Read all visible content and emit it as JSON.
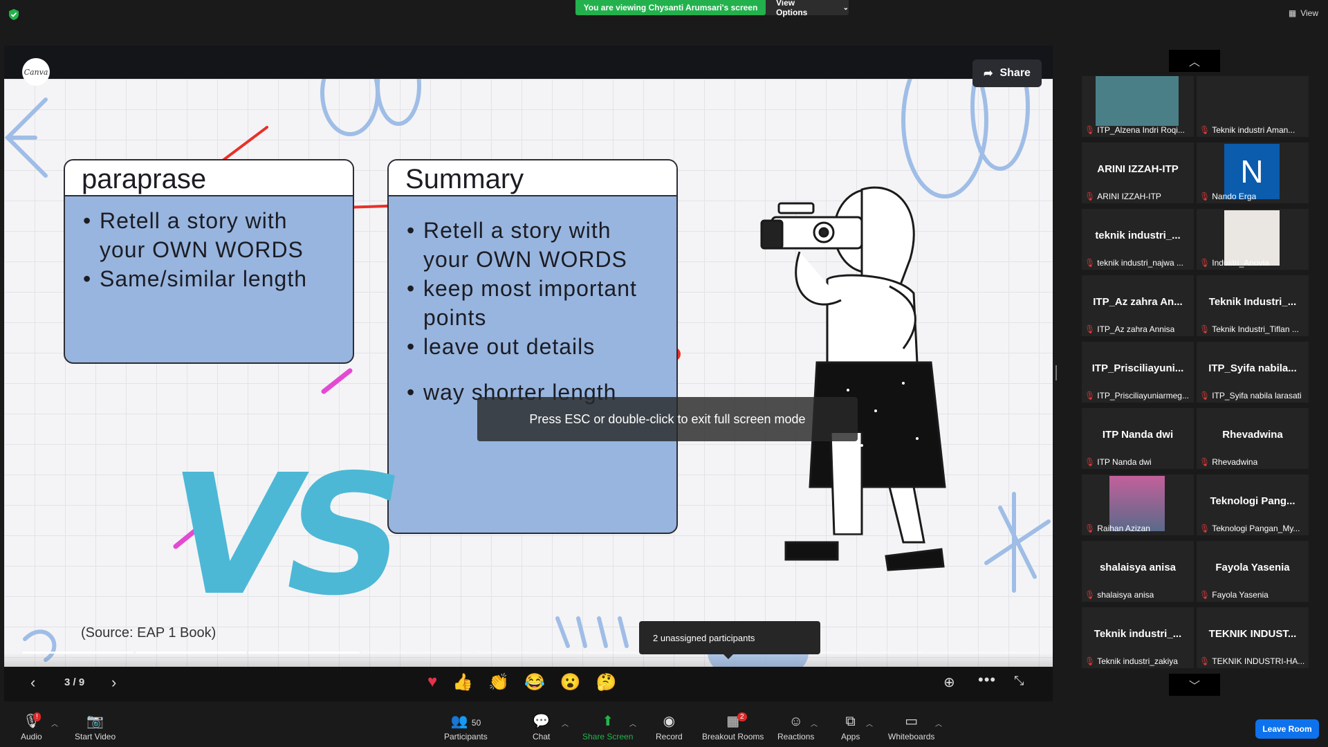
{
  "topbar": {
    "viewing_banner": "You are viewing Chysanti Arumsari's screen",
    "view_options": "View Options",
    "view": "View"
  },
  "canva": {
    "logo": "Canva",
    "share": "Share"
  },
  "slide": {
    "paraphrase": {
      "title": "paraprase",
      "bullets": [
        "Retell a story with your OWN WORDS",
        "Same/similar length"
      ]
    },
    "summary": {
      "title": "Summary",
      "bullets": [
        "Retell a story with your OWN WORDS",
        "keep most important points",
        "leave out details",
        "way shorter length"
      ]
    },
    "vs": "VS",
    "source": "(Source: EAP 1 Book)",
    "progress": {
      "current": 3,
      "total": 9
    }
  },
  "slide_controls": {
    "page": "3 / 9",
    "emojis": [
      "heart",
      "thumbs-up",
      "clap",
      "joy",
      "surprised",
      "thinking"
    ]
  },
  "esc_notice": "Press ESC or double-click to exit full screen mode",
  "unassigned": "2 unassigned participants",
  "participants": [
    {
      "display": "",
      "label": "ITP_Alzena Indri Roqi...",
      "kind": "video"
    },
    {
      "display": "",
      "label": "Teknik industri Aman...",
      "kind": "blank"
    },
    {
      "display": "ARINI IZZAH-ITP",
      "label": "ARINI IZZAH-ITP",
      "kind": "name"
    },
    {
      "display": "N",
      "label": "Nando Erga",
      "kind": "initial"
    },
    {
      "display": "teknik industri_...",
      "label": "teknik industri_najwa ...",
      "kind": "name"
    },
    {
      "display": "",
      "label": "Industri_Anovia",
      "kind": "photo"
    },
    {
      "display": "ITP_Az zahra An...",
      "label": "ITP_Az zahra Annisa",
      "kind": "name"
    },
    {
      "display": "Teknik Industri_...",
      "label": "Teknik Industri_Tiflan ...",
      "kind": "name"
    },
    {
      "display": "ITP_Prisciliayuni...",
      "label": "ITP_Prisciliayuniarmeg...",
      "kind": "name"
    },
    {
      "display": "ITP_Syifa nabila...",
      "label": "ITP_Syifa nabila larasati",
      "kind": "name"
    },
    {
      "display": "ITP Nanda dwi",
      "label": "ITP Nanda dwi",
      "kind": "name"
    },
    {
      "display": "Rhevadwina",
      "label": "Rhevadwina",
      "kind": "name"
    },
    {
      "display": "",
      "label": "Raihan Azizan",
      "kind": "photo2"
    },
    {
      "display": "Teknologi Pang...",
      "label": "Teknologi Pangan_My...",
      "kind": "name"
    },
    {
      "display": "shalaisya anisa",
      "label": "shalaisya anisa",
      "kind": "name"
    },
    {
      "display": "Fayola Yasenia",
      "label": "Fayola Yasenia",
      "kind": "name"
    },
    {
      "display": "Teknik industri_...",
      "label": "Teknik industri_zakiya",
      "kind": "name"
    },
    {
      "display": "TEKNIK INDUST...",
      "label": "TEKNIK INDUSTRI-HA...",
      "kind": "name"
    }
  ],
  "toolbar": {
    "audio": "Audio",
    "start_video": "Start Video",
    "participants": "Participants",
    "participants_count": "50",
    "chat": "Chat",
    "share_screen": "Share Screen",
    "record": "Record",
    "breakout_rooms": "Breakout Rooms",
    "breakout_badge": "2",
    "reactions": "Reactions",
    "apps": "Apps",
    "whiteboards": "Whiteboards",
    "leave_room": "Leave Room",
    "audio_badge": "!"
  },
  "colors": {
    "green_banner": "#23b14d",
    "leave_blue": "#0e72ed",
    "box_blue": "#97b5de",
    "vs_cyan": "#4cb8d6",
    "mute_red": "#e03a3a"
  }
}
